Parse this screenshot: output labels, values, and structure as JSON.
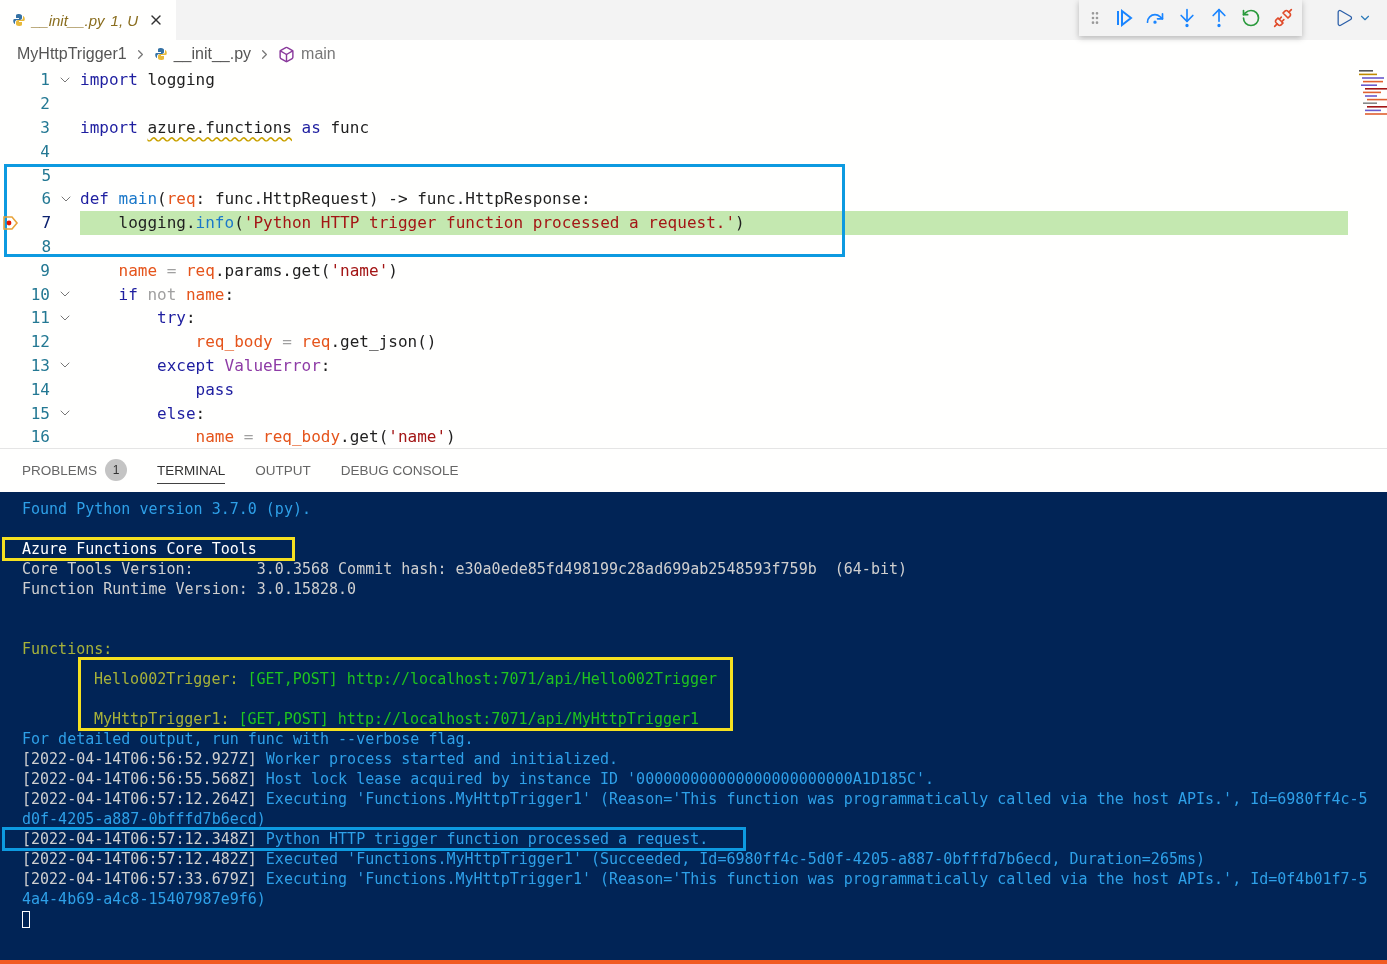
{
  "editor_tab": {
    "title": "__init__.py",
    "status": "1, U",
    "selected": true
  },
  "breadcrumb": [
    "MyHttpTrigger1",
    "__init__.py",
    "main"
  ],
  "code_groups": [
    {
      "lines": [
        {
          "number": "1",
          "fold": true,
          "current": false,
          "tokens": [
            {
              "t": "import",
              "kind": "keyword"
            },
            {
              "t": " logging",
              "kind": "plain"
            }
          ]
        },
        {
          "number": "2",
          "fold": false,
          "current": false
        },
        {
          "number": "3",
          "fold": false,
          "current": false,
          "tokens": [
            {
              "t": "import ",
              "kind": "keyword"
            },
            {
              "t": "azure.functions",
              "kind": "plain",
              "squiggle": true
            },
            {
              "t": " as",
              "kind": "keyword"
            },
            {
              "t": " func",
              "kind": "plain"
            }
          ]
        },
        {
          "number": "4",
          "fold": false,
          "current": false
        }
      ]
    },
    {
      "color": "#0d9ae0",
      "lines": [
        {
          "number": "5",
          "fold": false,
          "current": false
        },
        {
          "number": "6",
          "fold": true,
          "current": false,
          "tokens": [
            {
              "t": "def ",
              "kind": "keyword"
            },
            {
              "t": "main",
              "kind": "function"
            },
            {
              "t": "(",
              "kind": "plain"
            },
            {
              "t": "req",
              "kind": "variable"
            },
            {
              "t": ": func.HttpRequest) -> func.HttpResponse:",
              "kind": "plain"
            }
          ]
        },
        {
          "number": "7",
          "fold": false,
          "current": true,
          "tokens": [
            {
              "t": "    logging.",
              "kind": "plain"
            },
            {
              "t": "info",
              "kind": "function"
            },
            {
              "t": "(",
              "kind": "plain"
            },
            {
              "t": "'Python HTTP trigger function processed a request.'",
              "kind": "string"
            },
            {
              "t": ")",
              "kind": "plain"
            }
          ]
        },
        {
          "number": "8",
          "fold": false,
          "current": false
        }
      ]
    },
    {
      "lines": [
        {
          "number": "9",
          "fold": false,
          "current": false,
          "tokens": [
            {
              "t": "    name",
              "kind": "variable"
            },
            {
              "t": " = ",
              "kind": "operator"
            },
            {
              "t": "req",
              "kind": "variable"
            },
            {
              "t": ".params.get(",
              "kind": "plain"
            },
            {
              "t": "'name'",
              "kind": "string"
            },
            {
              "t": ")",
              "kind": "plain"
            }
          ]
        },
        {
          "number": "10",
          "fold": true,
          "current": false,
          "tokens": [
            {
              "t": "    if",
              "kind": "keyword"
            },
            {
              "t": " not ",
              "kind": "operator"
            },
            {
              "t": "name",
              "kind": "variable"
            },
            {
              "t": ":",
              "kind": "plain"
            }
          ]
        },
        {
          "number": "11",
          "fold": true,
          "current": false,
          "tokens": [
            {
              "t": "        try",
              "kind": "keyword"
            },
            {
              "t": ":",
              "kind": "plain"
            }
          ]
        },
        {
          "number": "12",
          "fold": false,
          "current": false,
          "tokens": [
            {
              "t": "            req_body",
              "kind": "variable"
            },
            {
              "t": " = ",
              "kind": "operator"
            },
            {
              "t": "req",
              "kind": "variable"
            },
            {
              "t": ".get_json()",
              "kind": "plain"
            }
          ]
        },
        {
          "number": "13",
          "fold": true,
          "current": false,
          "tokens": [
            {
              "t": "        except ",
              "kind": "keyword"
            },
            {
              "t": "ValueError",
              "kind": "type"
            },
            {
              "t": ":",
              "kind": "plain"
            }
          ]
        },
        {
          "number": "14",
          "fold": false,
          "current": false,
          "tokens": [
            {
              "t": "            pass",
              "kind": "keyword"
            }
          ]
        },
        {
          "number": "15",
          "fold": true,
          "current": false,
          "tokens": [
            {
              "t": "        else",
              "kind": "keyword"
            },
            {
              "t": ":",
              "kind": "plain"
            }
          ]
        },
        {
          "number": "16",
          "fold": false,
          "current": false,
          "tokens": [
            {
              "t": "            name",
              "kind": "variable"
            },
            {
              "t": " = ",
              "kind": "operator"
            },
            {
              "t": "req_body",
              "kind": "variable"
            },
            {
              "t": ".get(",
              "kind": "plain"
            },
            {
              "t": "'name'",
              "kind": "string"
            },
            {
              "t": ")",
              "kind": "plain"
            }
          ]
        }
      ]
    }
  ],
  "panel_tabs": [
    {
      "label": "PROBLEMS",
      "badge": "1",
      "selected": false
    },
    {
      "label": "TERMINAL",
      "selected": true
    },
    {
      "label": "OUTPUT",
      "selected": false
    },
    {
      "label": "DEBUG CONSOLE",
      "selected": false
    }
  ],
  "terminal_blocks": [
    {
      "indent": false,
      "lines": [
        {
          "kind": "text",
          "segments": [
            {
              "t": "Found Python version 3.7.0 (py).",
              "kind": "info"
            }
          ]
        },
        {
          "kind": "blank"
        }
      ]
    },
    {
      "color": "#f5e020",
      "indent": false,
      "lines": [
        {
          "kind": "text",
          "segments": [
            {
              "t": "Azure Functions Core Tools",
              "kind": "bright"
            }
          ]
        }
      ]
    },
    {
      "indent": false,
      "lines": [
        {
          "kind": "text",
          "segments": [
            {
              "t": "Core Tools Version:       3.0.3568 Commit hash: e30a0ede85fd498199c28ad699ab2548593f759b  (64-bit)",
              "kind": "plain"
            }
          ]
        },
        {
          "kind": "text",
          "segments": [
            {
              "t": "Function Runtime Version: 3.0.15828.0",
              "kind": "plain"
            }
          ]
        },
        {
          "kind": "blank"
        },
        {
          "kind": "blank"
        },
        {
          "kind": "text",
          "segments": [
            {
              "t": "Functions:",
              "kind": "label"
            }
          ]
        }
      ]
    },
    {
      "color": "#f5e020",
      "indent": true,
      "lines": [
        {
          "kind": "text",
          "segments": [
            {
              "t": "Hello002Trigger: ",
              "kind": "label"
            },
            {
              "t": "[GET,POST] http://localhost:7071/api/Hello002Trigger",
              "kind": "route"
            }
          ]
        },
        {
          "kind": "blank"
        },
        {
          "kind": "text",
          "segments": [
            {
              "t": "MyHttpTrigger1: ",
              "kind": "label"
            },
            {
              "t": "[GET,POST] http://localhost:7071/api/MyHttpTrigger1",
              "kind": "route"
            }
          ]
        }
      ]
    },
    {
      "indent": false,
      "lines": [
        {
          "kind": "text",
          "segments": [
            {
              "t": "For detailed output, run func with --verbose flag.",
              "kind": "info"
            }
          ]
        },
        {
          "kind": "text",
          "segments": [
            {
              "t": "[2022-04-14T06:56:52.927Z] ",
              "kind": "plain"
            },
            {
              "t": "Worker process started and initialized.",
              "kind": "info"
            }
          ]
        },
        {
          "kind": "text",
          "segments": [
            {
              "t": "[2022-04-14T06:56:55.568Z] ",
              "kind": "plain"
            },
            {
              "t": "Host lock lease acquired by instance ID '000000000000000000000000A1D185C'.",
              "kind": "info"
            }
          ]
        },
        {
          "kind": "text",
          "segments": [
            {
              "t": "[2022-04-14T06:57:12.264Z] ",
              "kind": "plain"
            },
            {
              "t": "Executing 'Functions.MyHttpTrigger1' (Reason='This function was programmatically called via the host APIs.', Id=6980ff4c-5",
              "kind": "info"
            }
          ]
        },
        {
          "kind": "text",
          "segments": [
            {
              "t": "d0f-4205-a887-0bfffd7b6ecd)",
              "kind": "info"
            }
          ]
        }
      ]
    },
    {
      "color": "#0d9ae0",
      "indent": false,
      "lines": [
        {
          "kind": "text",
          "segments": [
            {
              "t": "[2022-04-14T06:57:12.348Z] ",
              "kind": "plain"
            },
            {
              "t": "Python HTTP trigger function processed a request.",
              "kind": "info"
            }
          ]
        }
      ]
    },
    {
      "indent": false,
      "lines": [
        {
          "kind": "text",
          "segments": [
            {
              "t": "[2022-04-14T06:57:12.482Z] ",
              "kind": "plain"
            },
            {
              "t": "Executed 'Functions.MyHttpTrigger1' (Succeeded, Id=6980ff4c-5d0f-4205-a887-0bfffd7b6ecd, Duration=265ms)",
              "kind": "info"
            }
          ]
        },
        {
          "kind": "text",
          "segments": [
            {
              "t": "[2022-04-14T06:57:33.679Z] ",
              "kind": "plain"
            },
            {
              "t": "Executing 'Functions.MyHttpTrigger1' (Reason='This function was programmatically called via the host APIs.', Id=0f4b01f7-5",
              "kind": "info"
            }
          ]
        },
        {
          "kind": "text",
          "segments": [
            {
              "t": "4a4-4b69-a4c8-15407987e9f6)",
              "kind": "info"
            }
          ]
        },
        {
          "kind": "cursor"
        }
      ]
    }
  ]
}
